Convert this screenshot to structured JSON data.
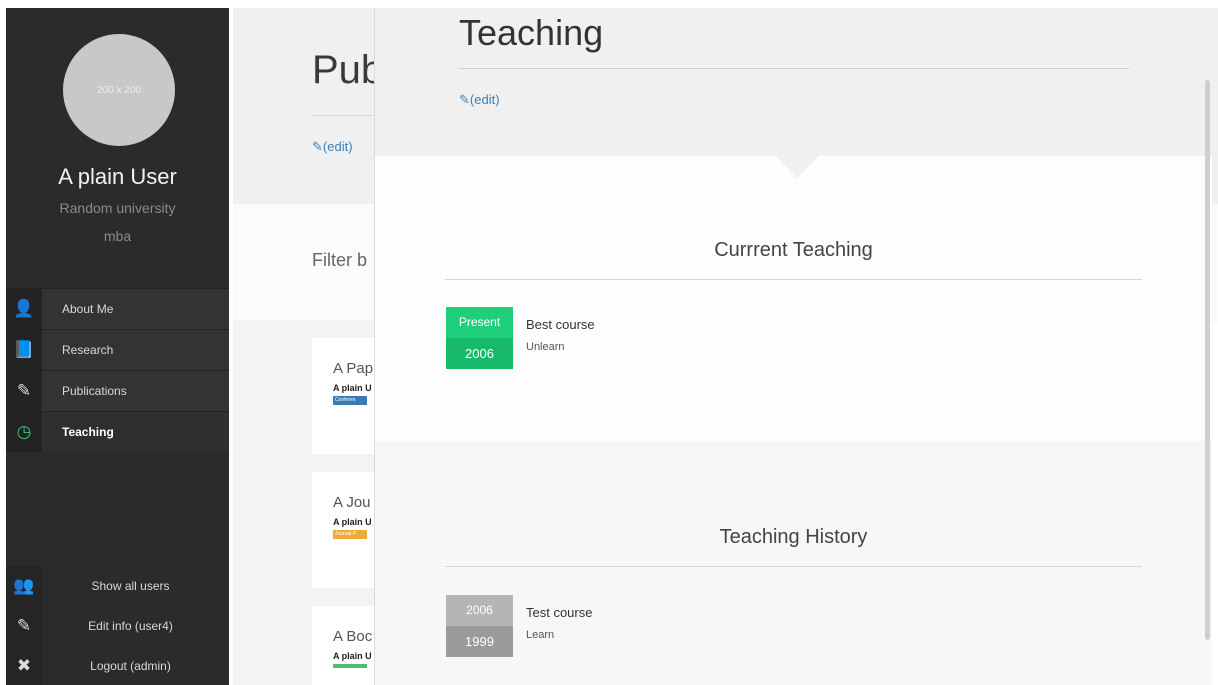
{
  "sidebar": {
    "avatar_text": "200 x 200",
    "user_name": "A plain User",
    "university": "Random university",
    "degree": "mba",
    "nav": [
      {
        "label": "About Me",
        "icon": "user-icon",
        "glyph": "👤"
      },
      {
        "label": "Research",
        "icon": "book-icon",
        "glyph": "📘"
      },
      {
        "label": "Publications",
        "icon": "edit-icon",
        "glyph": "✎"
      },
      {
        "label": "Teaching",
        "icon": "clock-icon",
        "glyph": "◷",
        "active": true
      }
    ],
    "bottom_nav": [
      {
        "label": "Show all users",
        "icon": "users-icon",
        "glyph": "👥"
      },
      {
        "label": "Edit info (user4)",
        "icon": "edit-icon",
        "glyph": "✎"
      },
      {
        "label": "Logout (admin)",
        "icon": "user-remove-icon",
        "glyph": "✖"
      }
    ]
  },
  "background_page": {
    "title": "Pub",
    "edit_label": "(edit)",
    "filter_label": "Filter b",
    "cards": [
      {
        "title": "A Pap",
        "author": "A plain U",
        "tag": "Conferen",
        "tag_color": "#3a7ab8"
      },
      {
        "title": "A Jou",
        "author": "A plain U",
        "tag": "Journal P",
        "tag_color": "#efaa3c"
      },
      {
        "title": "A Boc",
        "author": "A plain U",
        "tag": "",
        "tag_color": "#4cbf6a"
      }
    ]
  },
  "panel": {
    "title": "Teaching",
    "edit_label": "(edit)",
    "current": {
      "heading": "Currrent Teaching",
      "entries": [
        {
          "end": "Present",
          "start": "2006",
          "course": "Best course",
          "place": "Unlearn"
        }
      ]
    },
    "history": {
      "heading": "Teaching History",
      "entries": [
        {
          "end": "2006",
          "start": "1999",
          "course": "Test course",
          "place": "Learn"
        }
      ]
    }
  },
  "colors": {
    "current_end": "#1fcf7c",
    "current_start": "#17b96b",
    "history_end": "#b5b5b5",
    "history_start": "#9b9b9b",
    "link": "#3b7fb5",
    "active_icon": "#3cc77f"
  }
}
